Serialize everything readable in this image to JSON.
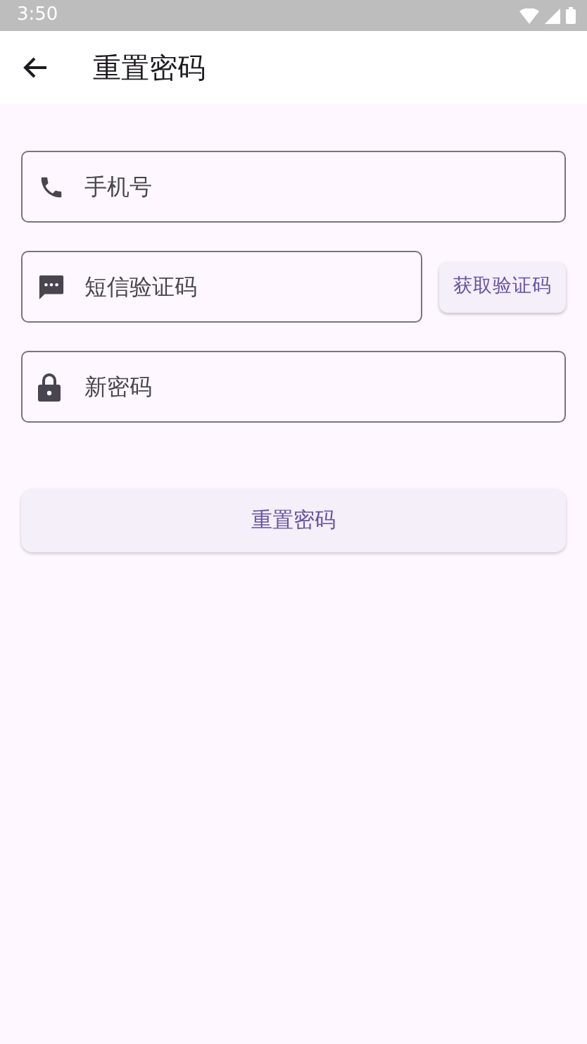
{
  "status_bar": {
    "time": "3:50"
  },
  "app_bar": {
    "title": "重置密码"
  },
  "fields": [
    {
      "kind": "phone",
      "placeholder": "手机号"
    },
    {
      "kind": "code",
      "placeholder": "短信验证码",
      "button": "获取验证码"
    },
    {
      "kind": "password",
      "placeholder": "新密码"
    }
  ],
  "submit_button": "重置密码"
}
